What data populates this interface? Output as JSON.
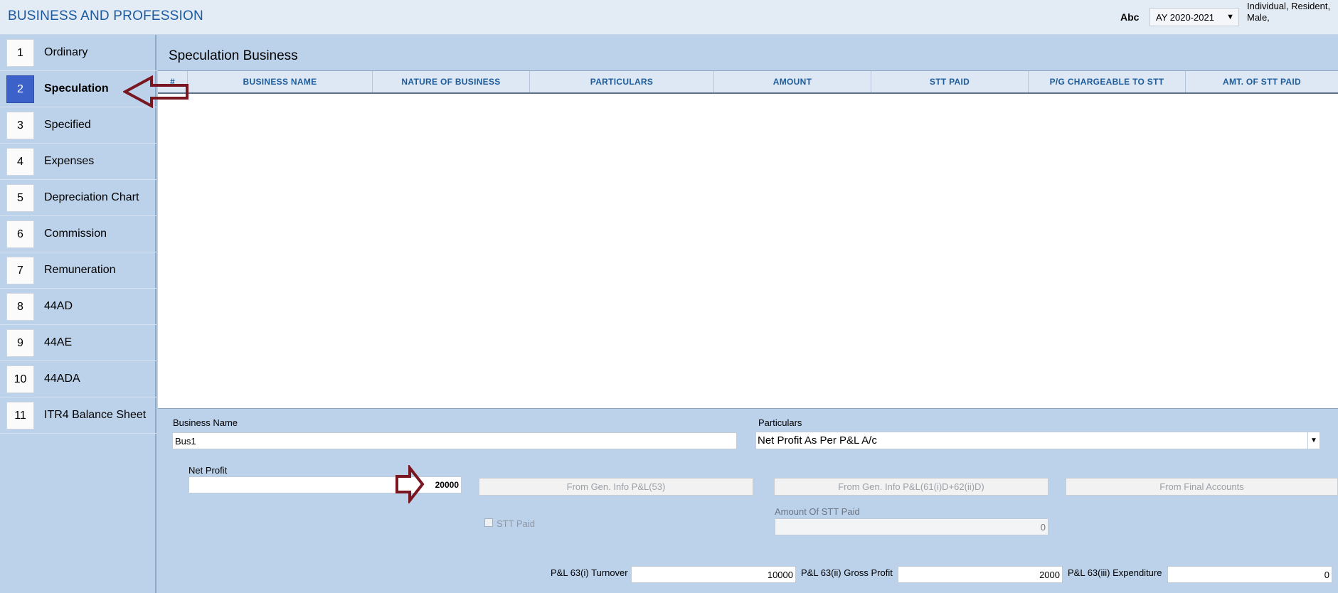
{
  "header": {
    "title": "BUSINESS AND PROFESSION",
    "user_name": "Abc",
    "assessment_year": "AY 2020-2021",
    "status_info": "Individual, Resident, Male,"
  },
  "sidebar": {
    "items": [
      {
        "num": "1",
        "label": "Ordinary"
      },
      {
        "num": "2",
        "label": "Speculation"
      },
      {
        "num": "3",
        "label": "Specified"
      },
      {
        "num": "4",
        "label": "Expenses"
      },
      {
        "num": "5",
        "label": "Depreciation Chart"
      },
      {
        "num": "6",
        "label": "Commission"
      },
      {
        "num": "7",
        "label": "Remuneration"
      },
      {
        "num": "8",
        "label": "44AD"
      },
      {
        "num": "9",
        "label": "44AE"
      },
      {
        "num": "10",
        "label": "44ADA"
      },
      {
        "num": "11",
        "label": "ITR4 Balance Sheet"
      }
    ],
    "active_index": 1
  },
  "main": {
    "section_title": "Speculation Business",
    "table": {
      "columns": [
        "#",
        "BUSINESS NAME",
        "NATURE OF BUSINESS",
        "PARTICULARS",
        "AMOUNT",
        "STT PAID",
        "P/G CHARGEABLE TO STT",
        "AMT. OF STT PAID"
      ],
      "rows": []
    }
  },
  "form": {
    "business_name_label": "Business Name",
    "business_name_value": "Bus1",
    "particulars_label": "Particulars",
    "particulars_value": "Net Profit As Per P&L A/c",
    "net_profit_label": "Net Profit",
    "net_profit_value": "20000",
    "btn_gen_info_53": "From Gen. Info P&L(53)",
    "btn_gen_info_61": "From Gen. Info P&L(61(i)D+62(ii)D)",
    "btn_final_accounts": "From Final Accounts",
    "stt_paid_label": "STT Paid",
    "amount_stt_label": "Amount Of STT Paid",
    "amount_stt_value": "0",
    "turnover_label": "P&L 63(i) Turnover",
    "turnover_value": "10000",
    "gross_profit_label": "P&L 63(ii) Gross Profit",
    "gross_profit_value": "2000",
    "expenditure_label": "P&L 63(iii) Expenditure",
    "expenditure_value": "0"
  },
  "colors": {
    "accent": "#1c5aa0",
    "active_item": "#3c61c8",
    "annotation_arrow": "#7a1620",
    "panel_bg": "#bcd2ea"
  }
}
